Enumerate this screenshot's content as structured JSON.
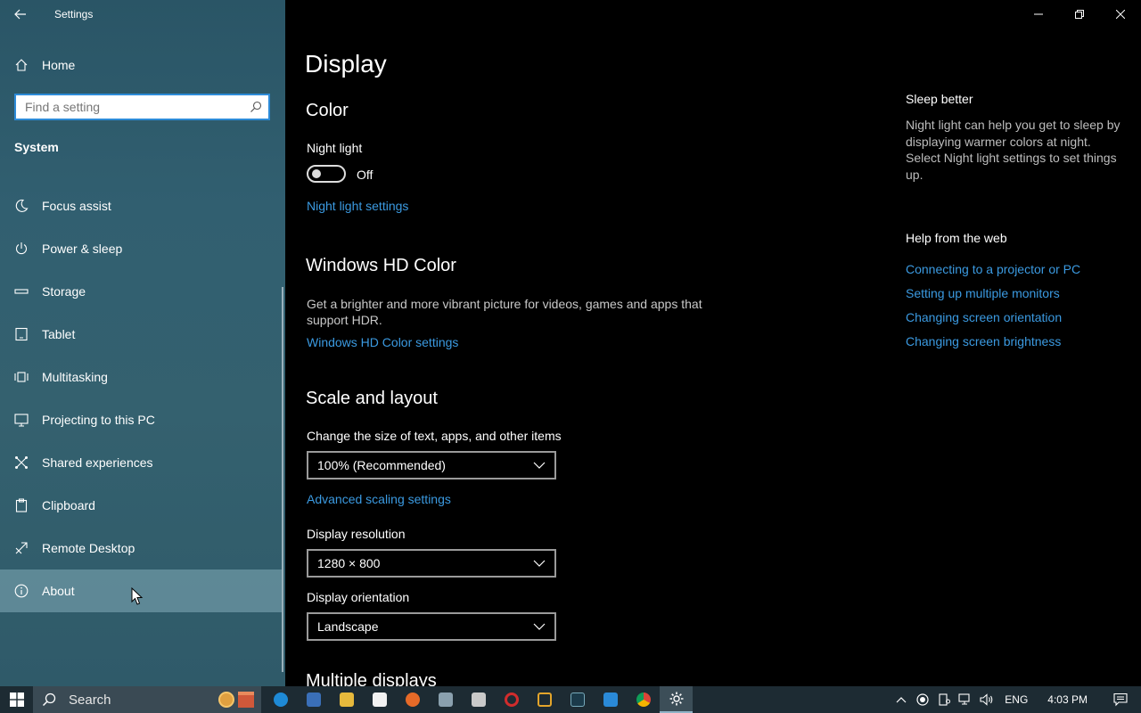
{
  "window": {
    "title": "Settings"
  },
  "sidebar": {
    "home_label": "Home",
    "search_placeholder": "Find a setting",
    "section": "System",
    "items": [
      {
        "label": "Focus assist",
        "icon": "moon-icon"
      },
      {
        "label": "Power & sleep",
        "icon": "power-icon"
      },
      {
        "label": "Storage",
        "icon": "storage-icon"
      },
      {
        "label": "Tablet",
        "icon": "tablet-icon"
      },
      {
        "label": "Multitasking",
        "icon": "multitasking-icon"
      },
      {
        "label": "Projecting to this PC",
        "icon": "projecting-icon"
      },
      {
        "label": "Shared experiences",
        "icon": "shared-icon"
      },
      {
        "label": "Clipboard",
        "icon": "clipboard-icon"
      },
      {
        "label": "Remote Desktop",
        "icon": "remote-desktop-icon"
      },
      {
        "label": "About",
        "icon": "info-icon",
        "selected": true
      }
    ]
  },
  "main": {
    "page_title": "Display",
    "color": {
      "heading": "Color",
      "night_light_label": "Night light",
      "night_light_state": "Off",
      "night_light_link": "Night light settings"
    },
    "hdr": {
      "heading": "Windows HD Color",
      "description": "Get a brighter and more vibrant picture for videos, games and apps that support HDR.",
      "link": "Windows HD Color settings"
    },
    "scale": {
      "heading": "Scale and layout",
      "size_label": "Change the size of text, apps, and other items",
      "size_value": "100% (Recommended)",
      "advanced_link": "Advanced scaling settings",
      "resolution_label": "Display resolution",
      "resolution_value": "1280 × 800",
      "orientation_label": "Display orientation",
      "orientation_value": "Landscape"
    },
    "multiple_displays_heading": "Multiple displays"
  },
  "side_panel": {
    "sleep_title": "Sleep better",
    "sleep_desc": "Night light can help you get to sleep by displaying warmer colors at night. Select Night light settings to set things up.",
    "help_title": "Help from the web",
    "links": [
      "Connecting to a projector or PC",
      "Setting up multiple monitors",
      "Changing screen orientation",
      "Changing screen brightness"
    ]
  },
  "taskbar": {
    "search_label": "Search",
    "language": "ENG",
    "time": "4:03 PM"
  },
  "colors": {
    "accent": "#3b9ae1",
    "sidebar": "#315f70",
    "taskbar": "#1d2b33"
  }
}
